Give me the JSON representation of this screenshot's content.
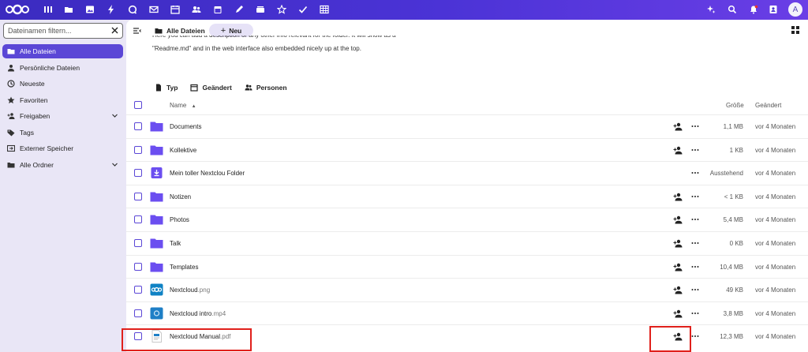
{
  "topbar": {
    "apps": [
      "dashboard-icon",
      "files-icon",
      "photos-icon",
      "activity-icon",
      "talk-icon",
      "mail-icon",
      "calendar-mail-icon",
      "contacts-icon",
      "calendar-icon",
      "notes-icon",
      "deck-icon",
      "starred-icon",
      "tasks-icon",
      "tables-icon"
    ],
    "right_icons": [
      "assistant-icon",
      "search-icon",
      "notifications-icon",
      "contacts-menu-icon"
    ],
    "avatar_letter": "A"
  },
  "sidebar": {
    "filter_placeholder": "Dateinamen filtern...",
    "items": [
      {
        "label": "Alle Dateien",
        "icon": "folder-icon",
        "active": true
      },
      {
        "label": "Persönliche Dateien",
        "icon": "person-icon"
      },
      {
        "label": "Neueste",
        "icon": "history-icon"
      },
      {
        "label": "Favoriten",
        "icon": "star-icon"
      },
      {
        "label": "Freigaben",
        "icon": "share-icon",
        "expandable": true
      },
      {
        "label": "Tags",
        "icon": "tag-icon"
      },
      {
        "label": "Externer Speicher",
        "icon": "external-storage-icon"
      },
      {
        "label": "Alle Ordner",
        "icon": "folder-tree-icon",
        "expandable": true
      }
    ]
  },
  "main": {
    "breadcrumb": "Alle Dateien",
    "new_label": "Neu",
    "readme_line1": "Here you can add a description or any other info relevant for the folder. It will show as a",
    "readme_line2": "\"Readme.md\" and in the web interface also embedded nicely up at the top.",
    "filters": [
      "Typ",
      "Geändert",
      "Personen"
    ],
    "columns": {
      "name": "Name",
      "size": "Größe",
      "modified": "Geändert"
    },
    "files": [
      {
        "name": "Documents",
        "ext": "",
        "type": "folder",
        "size": "1,1 MB",
        "modified": "vor 4 Monaten",
        "share": true
      },
      {
        "name": "Kollektive",
        "ext": "",
        "type": "folder",
        "size": "1 KB",
        "modified": "vor 4 Monaten",
        "share": true
      },
      {
        "name": "Mein toller Nextclou Folder",
        "ext": "",
        "type": "folder-download",
        "size": "Ausstehend",
        "modified": "vor 4 Monaten",
        "share": false
      },
      {
        "name": "Notizen",
        "ext": "",
        "type": "folder",
        "size": "< 1 KB",
        "modified": "vor 4 Monaten",
        "share": true
      },
      {
        "name": "Photos",
        "ext": "",
        "type": "folder",
        "size": "5,4 MB",
        "modified": "vor 4 Monaten",
        "share": true
      },
      {
        "name": "Talk",
        "ext": "",
        "type": "folder",
        "size": "0 KB",
        "modified": "vor 4 Monaten",
        "share": true
      },
      {
        "name": "Templates",
        "ext": "",
        "type": "folder",
        "size": "10,4 MB",
        "modified": "vor 4 Monaten",
        "share": true
      },
      {
        "name": "Nextcloud",
        "ext": ".png",
        "type": "image",
        "size": "49 KB",
        "modified": "vor 4 Monaten",
        "share": true
      },
      {
        "name": "Nextcloud intro",
        "ext": ".mp4",
        "type": "video",
        "size": "3,8 MB",
        "modified": "vor 4 Monaten",
        "share": true
      },
      {
        "name": "Nextcloud Manual",
        "ext": ".pdf",
        "type": "pdf",
        "size": "12,3 MB",
        "modified": "vor 4 Monaten",
        "share": true
      }
    ]
  },
  "colors": {
    "accent": "#5b47d6",
    "folder": "#6b4ef0",
    "highlight": "#e0201b"
  }
}
